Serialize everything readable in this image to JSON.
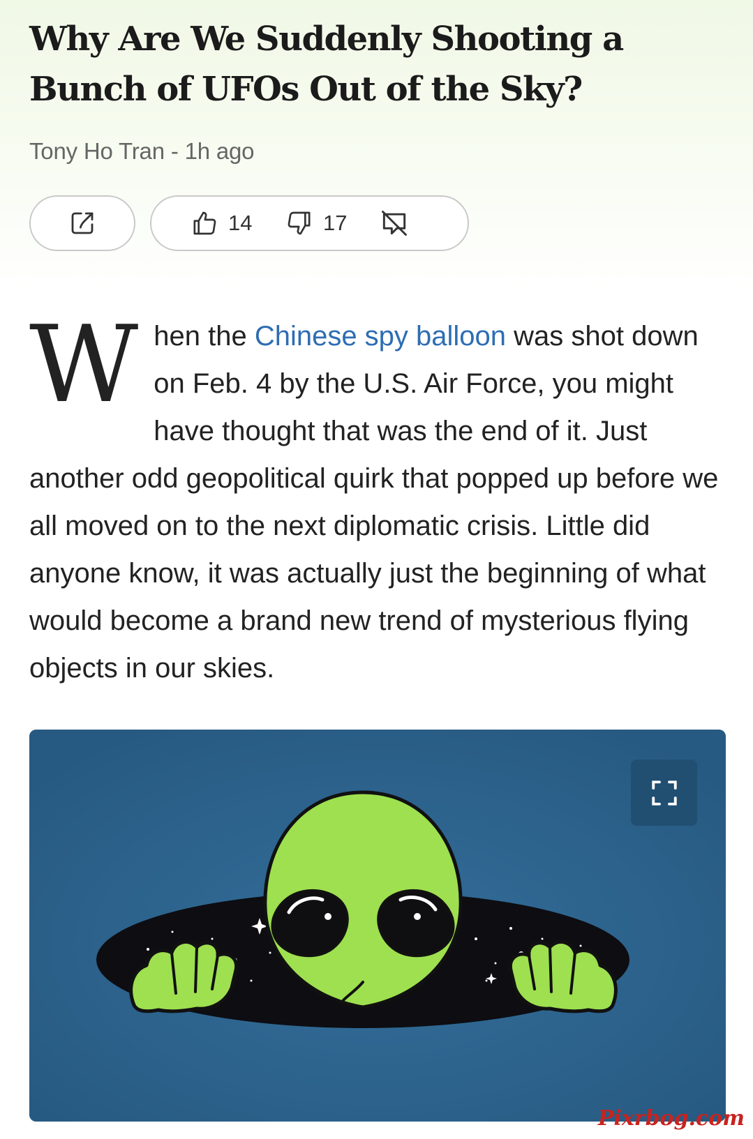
{
  "article": {
    "title": "Why Are We Suddenly Shooting a Bunch of UFOs Out of the Sky?",
    "byline": "Tony Ho Tran - 1h ago"
  },
  "actions": {
    "share_icon": "share-icon",
    "like_icon": "thumbs-up-icon",
    "like_count": "14",
    "dislike_icon": "thumbs-down-icon",
    "dislike_count": "17",
    "comments_icon": "comments-off-icon"
  },
  "body": {
    "drop_cap": "W",
    "lead_before_link": "hen the ",
    "link_text": "Chinese spy balloon",
    "lead_after_link": " was shot down on Feb. 4 by the U.S. Air Force, you might have thought that was the end of it. Just another odd geopolitical quirk that popped up before we all moved on to the next diplomatic crisis. Little did anyone know, it was actually just the beginning of what would become a brand new trend of mysterious flying objects in our skies."
  },
  "image": {
    "subject": "alien-peeking-from-space-hole-illustration",
    "expand_icon": "fullscreen-icon"
  },
  "watermark": "Pixrbog.com",
  "colors": {
    "link": "#2e6db3",
    "hero_background": "#2e6590",
    "alien_green": "#9ee04f",
    "watermark": "#c8231f"
  }
}
